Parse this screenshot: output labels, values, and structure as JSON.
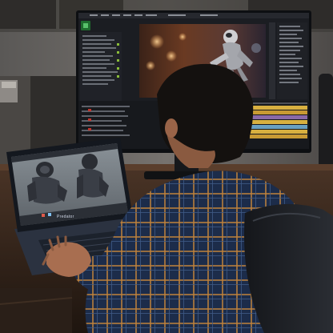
{
  "laptop": {
    "brand": "Predator"
  },
  "colors": {
    "wall": "#6b6a68",
    "desk": "#3a2a1e",
    "shirt_base": "#1f3050",
    "shirt_check": "#c0823a",
    "monitor_bezel": "#0d0f12",
    "editor_bg": "#1b1d22",
    "timeline_accent": "#d8b040",
    "laptop_body": "#2b3240"
  },
  "icons": {
    "app_logo": "green-app-icon"
  }
}
